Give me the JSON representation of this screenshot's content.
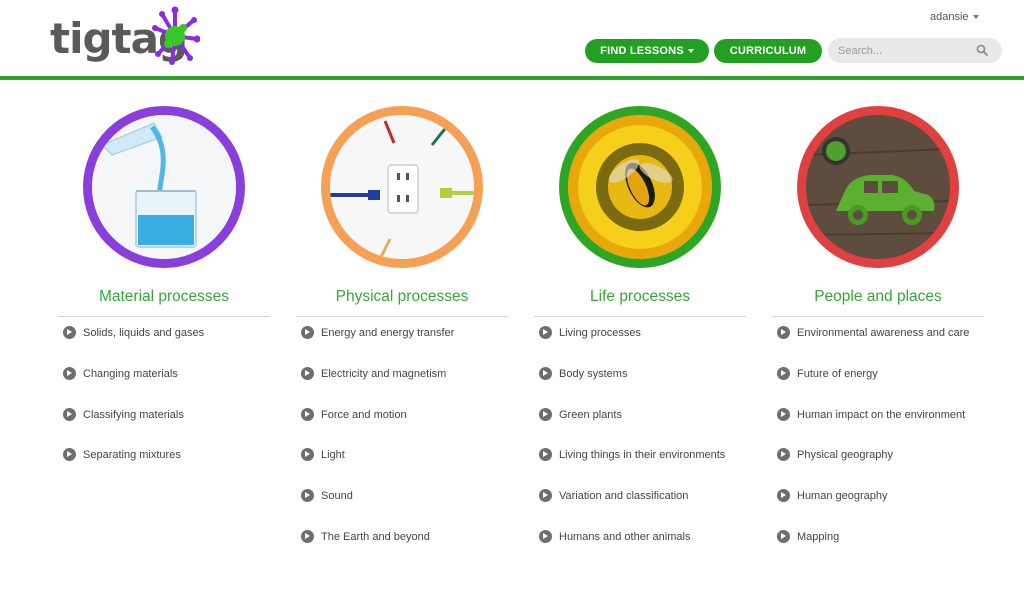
{
  "header": {
    "logo_text": "tigtag",
    "user_name": "adansie",
    "find_lessons_label": "FIND LESSONS",
    "curriculum_label": "CURRICULUM",
    "search_placeholder": "Search..."
  },
  "colors": {
    "brand_green": "#2aa52a",
    "purple": "#8a3fdc",
    "orange": "#f5a055",
    "green": "#2fa524",
    "red": "#e04040"
  },
  "categories": [
    {
      "title": "Material processes",
      "ring_color": "purple",
      "image_icon": "beaker-icon",
      "items": [
        "Solids, liquids and gases",
        "Changing materials",
        "Classifying materials",
        "Separating mixtures"
      ]
    },
    {
      "title": "Physical processes",
      "ring_color": "orange",
      "image_icon": "power-outlet-icon",
      "items": [
        "Energy and energy transfer",
        "Electricity and magnetism",
        "Force and motion",
        "Light",
        "Sound",
        "The Earth and beyond"
      ]
    },
    {
      "title": "Life processes",
      "ring_color": "green",
      "image_icon": "hoverfly-flower-icon",
      "items": [
        "Living processes",
        "Body systems",
        "Green plants",
        "Living things in their environments",
        "Variation and classification",
        "Humans and other animals"
      ]
    },
    {
      "title": "People and places",
      "ring_color": "red",
      "image_icon": "green-car-icon",
      "items": [
        "Environmental awareness and care",
        "Future of energy",
        "Human impact on the environment",
        "Physical geography",
        "Human geography",
        "Mapping"
      ]
    }
  ]
}
